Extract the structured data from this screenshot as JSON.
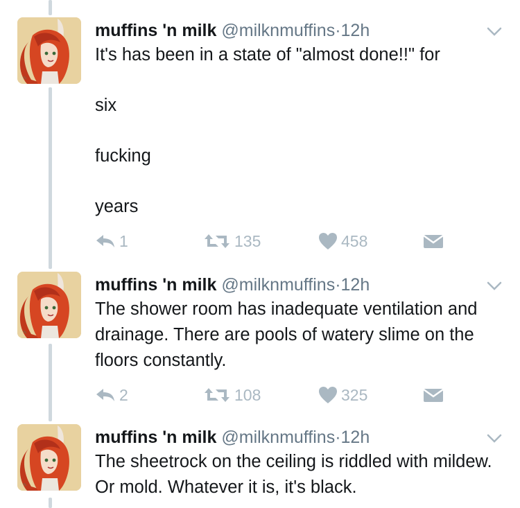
{
  "author": {
    "name": "muffins 'n milk",
    "handle": "@milknmuffins",
    "separator": "·"
  },
  "tweets": [
    {
      "time": "12h",
      "paragraphs": [
        "It's has been in a state of \"almost done!!\" for",
        "six",
        "fucking",
        "years"
      ],
      "replies": "1",
      "retweets": "135",
      "likes": "458"
    },
    {
      "time": "12h",
      "paragraphs": [
        "The shower room has inadequate ventilation and drainage. There are pools of watery slime on the floors constantly."
      ],
      "replies": "2",
      "retweets": "108",
      "likes": "325"
    },
    {
      "time": "12h",
      "paragraphs": [
        "The sheetrock on the ceiling is riddled with mildew. Or mold. Whatever it is, it's black."
      ]
    }
  ],
  "colors": {
    "text": "#14171a",
    "meta": "#657786",
    "action_icons": "#aab8c2",
    "thread_line": "#cfd8de"
  },
  "icons": [
    "avatar-illustration",
    "chevron-down-icon",
    "reply-icon",
    "retweet-icon",
    "heart-icon",
    "direct-message-icon"
  ]
}
